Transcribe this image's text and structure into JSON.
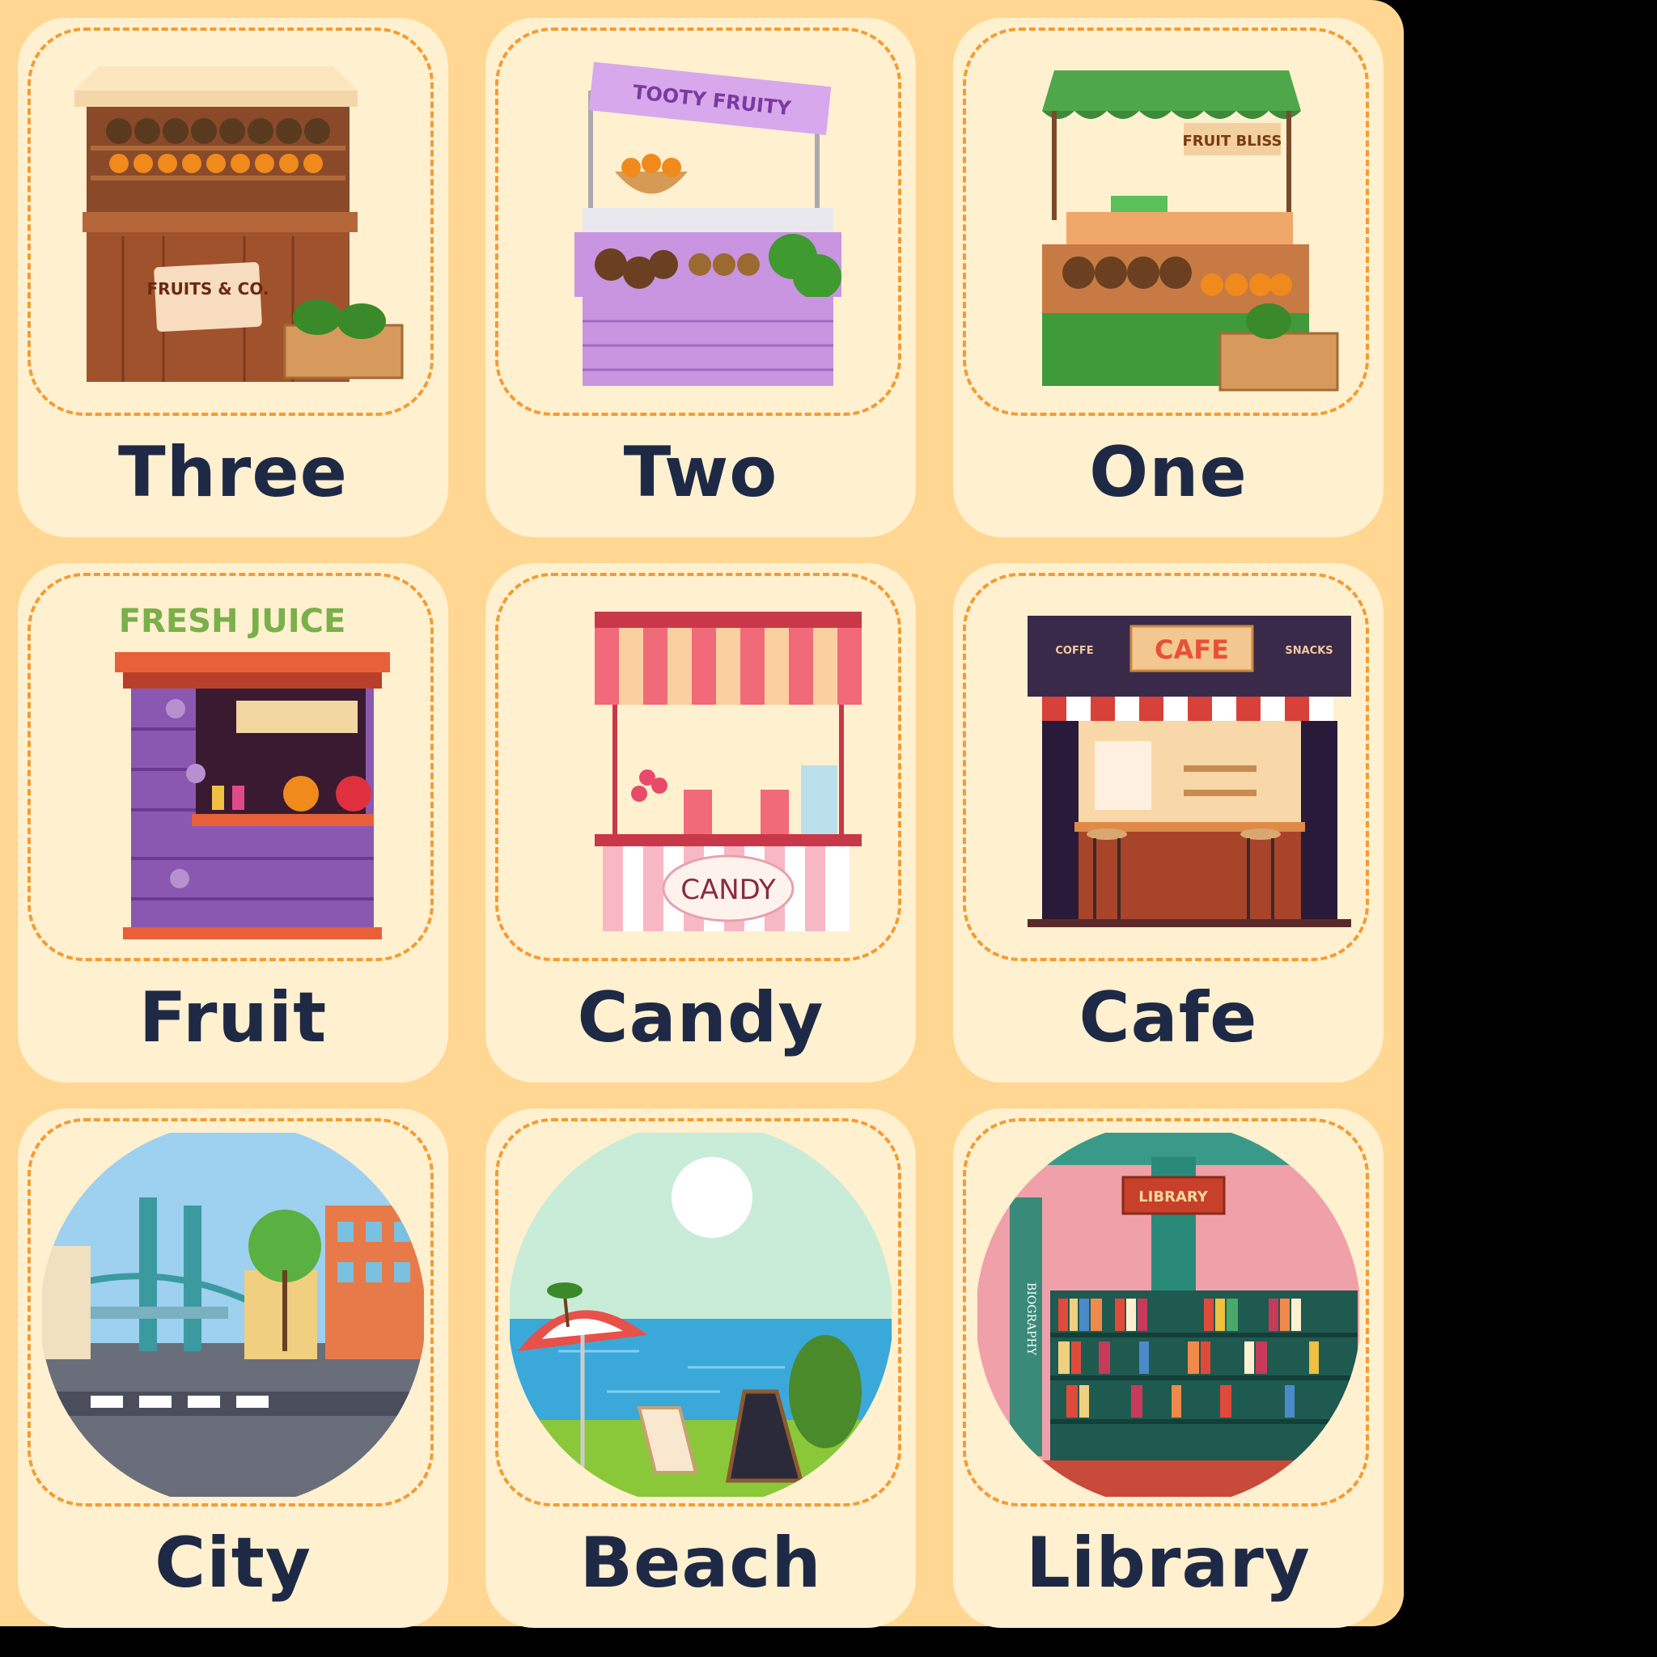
{
  "cards": [
    {
      "id": "three",
      "label": "Three",
      "sign": "FRUITS & CO."
    },
    {
      "id": "two",
      "label": "Two",
      "sign": "TOOTY FRUITY"
    },
    {
      "id": "one",
      "label": "One",
      "sign": "FRUIT BLISS"
    },
    {
      "id": "fruit",
      "label": "Fruit",
      "sign": "FRESH JUICE"
    },
    {
      "id": "candy",
      "label": "Candy",
      "sign": "CANDY"
    },
    {
      "id": "cafe",
      "label": "Cafe",
      "sign": "CAFE",
      "sign_left": "COFFE",
      "sign_right": "SNACKS"
    },
    {
      "id": "city",
      "label": "City"
    },
    {
      "id": "beach",
      "label": "Beach"
    },
    {
      "id": "library",
      "label": "Library",
      "sign": "LIBRARY",
      "shelf_text": "BIOGRAPHY"
    }
  ],
  "colors": {
    "page_bg": "#ffd692",
    "card_bg": "#fff0cf",
    "dash": "#f39c33",
    "label": "#1e2a45"
  }
}
